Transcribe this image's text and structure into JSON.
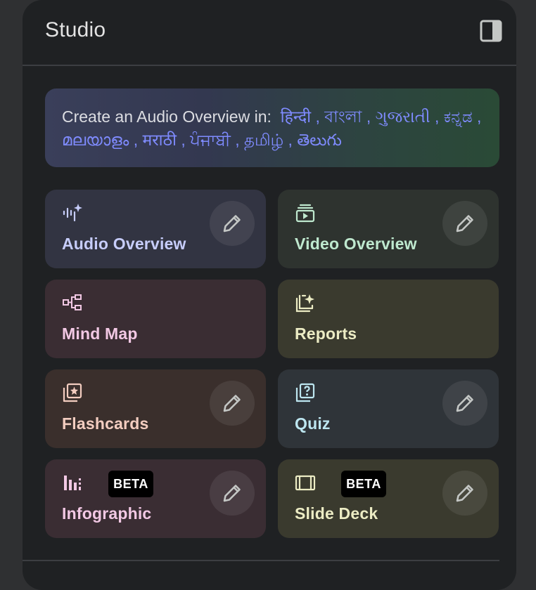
{
  "header": {
    "title": "Studio",
    "toggle_icon": "side-panel-icon"
  },
  "banner": {
    "prefix": "Create an Audio Overview in:",
    "languages": [
      "हिन्दी",
      "বাংলা",
      "ગુજરાતી",
      "ಕನ್ನಡ",
      "മലയാളം",
      "मराठी",
      "ਪੰਜਾਬੀ",
      "தமிழ்",
      "తెలుగు"
    ],
    "separator": ","
  },
  "tools": [
    {
      "label": "Audio Overview",
      "icon": "audio-waveform-sparkle-icon",
      "editable": true,
      "beta": ""
    },
    {
      "label": "Video Overview",
      "icon": "video-stack-icon",
      "editable": true,
      "beta": ""
    },
    {
      "label": "Mind Map",
      "icon": "mind-map-icon",
      "editable": false,
      "beta": ""
    },
    {
      "label": "Reports",
      "icon": "reports-sparkle-icon",
      "editable": false,
      "beta": ""
    },
    {
      "label": "Flashcards",
      "icon": "flashcards-icon",
      "editable": true,
      "beta": ""
    },
    {
      "label": "Quiz",
      "icon": "quiz-icon",
      "editable": true,
      "beta": ""
    },
    {
      "label": "Infographic",
      "icon": "infographic-bars-icon",
      "editable": true,
      "beta": "BETA"
    },
    {
      "label": "Slide Deck",
      "icon": "slide-deck-icon",
      "editable": true,
      "beta": "BETA"
    }
  ],
  "colors": {
    "audio_bg": "#323442",
    "audio_fg": "#c7cdfb",
    "video_bg": "#2e332f",
    "video_fg": "#bfe9cf",
    "mindmap_bg": "#3a2d33",
    "mindmap_fg": "#f2c8e4",
    "reports_bg": "#3a3a2e",
    "reports_fg": "#ececc4",
    "flash_bg": "#3a2f2c",
    "flash_fg": "#f3cdc0",
    "quiz_bg": "#2f3439",
    "quiz_fg": "#bde6f0",
    "info_bg": "#3a2d33",
    "info_fg": "#f2c8e4",
    "slide_bg": "#3a3a2e",
    "slide_fg": "#ececc4"
  }
}
